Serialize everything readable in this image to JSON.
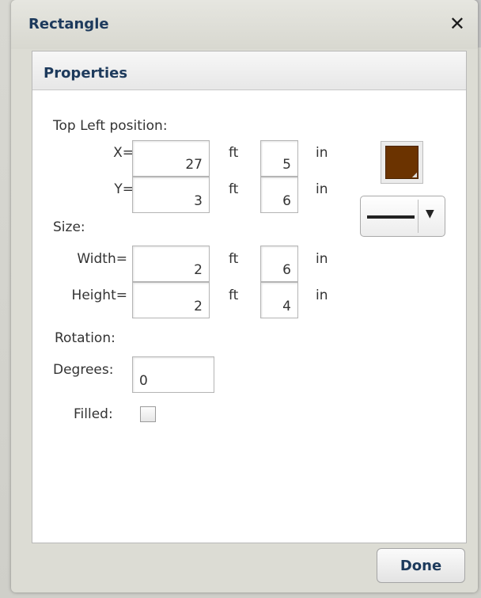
{
  "dialog": {
    "title": "Rectangle",
    "close_symbol": "✕"
  },
  "panel": {
    "header": "Properties"
  },
  "position": {
    "label": "Top Left position:",
    "x_label": "X=",
    "y_label": "Y=",
    "x_ft": "27",
    "x_in": "5",
    "y_ft": "3",
    "y_in": "6"
  },
  "size": {
    "label": "Size:",
    "width_label": "Width=",
    "height_label": "Height=",
    "width_ft": "2",
    "width_in": "6",
    "height_ft": "2",
    "height_in": "4"
  },
  "units": {
    "ft": "ft",
    "in": "in"
  },
  "rotation": {
    "label": "Rotation:",
    "degrees_label": "Degrees:",
    "degrees_value": "0"
  },
  "filled": {
    "label": "Filled:",
    "checked": false
  },
  "style": {
    "color": "#6b3300",
    "line_style": "solid",
    "dropdown_arrow": "▼"
  },
  "buttons": {
    "done": "Done"
  }
}
